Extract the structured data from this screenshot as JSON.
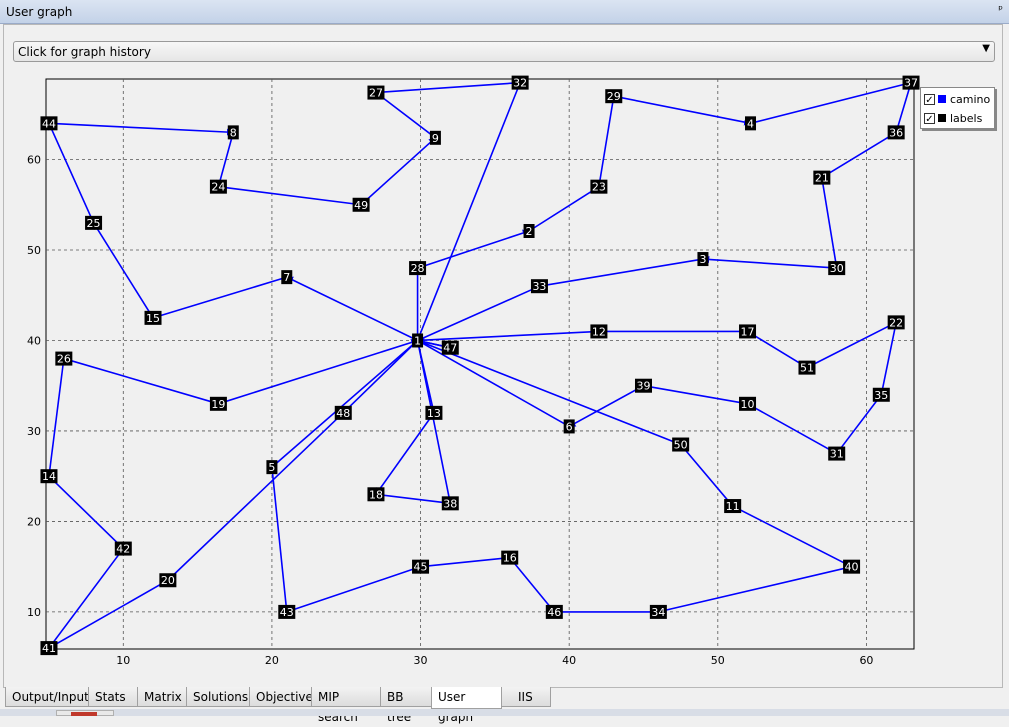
{
  "window": {
    "title": "User graph",
    "pin_glyph": "ᵖ"
  },
  "history": {
    "label": "Click for graph history",
    "dropdown_glyph": "▼"
  },
  "legend": [
    {
      "label": "camino",
      "checked": true,
      "color": "#0000ff"
    },
    {
      "label": "labels",
      "checked": true,
      "color": "#000000"
    }
  ],
  "tabs": [
    "Output/Input",
    "Stats",
    "Matrix",
    "Solutions",
    "Objective",
    "MIP search",
    "BB tree",
    "User graph",
    "IIS"
  ],
  "active_tab": "User graph",
  "chart_data": {
    "type": "scatter",
    "title": "",
    "xlabel": "",
    "ylabel": "",
    "xlim": [
      4.8,
      63.2
    ],
    "ylim": [
      5.9,
      68.9
    ],
    "grid": true,
    "xticks": [
      10,
      20,
      30,
      40,
      50,
      60
    ],
    "yticks": [
      10,
      20,
      30,
      40,
      50,
      60
    ],
    "legend_position": "top-right",
    "edge_color": "#0000ff",
    "nodes": [
      {
        "id": "1",
        "x": 29.8,
        "y": 40
      },
      {
        "id": "2",
        "x": 37.3,
        "y": 52.1
      },
      {
        "id": "3",
        "x": 49.0,
        "y": 49.0
      },
      {
        "id": "4",
        "x": 52.2,
        "y": 64.0
      },
      {
        "id": "5",
        "x": 20.0,
        "y": 26.0
      },
      {
        "id": "6",
        "x": 40.0,
        "y": 30.5
      },
      {
        "id": "7",
        "x": 21.0,
        "y": 47.0
      },
      {
        "id": "8",
        "x": 17.4,
        "y": 63.0
      },
      {
        "id": "9",
        "x": 31.0,
        "y": 62.4
      },
      {
        "id": "10",
        "x": 52.0,
        "y": 33.0
      },
      {
        "id": "11",
        "x": 51.0,
        "y": 21.7
      },
      {
        "id": "12",
        "x": 42.0,
        "y": 41.0
      },
      {
        "id": "13",
        "x": 30.9,
        "y": 32.0
      },
      {
        "id": "14",
        "x": 5.0,
        "y": 25.0
      },
      {
        "id": "15",
        "x": 12.0,
        "y": 42.5
      },
      {
        "id": "16",
        "x": 36.0,
        "y": 16.0
      },
      {
        "id": "17",
        "x": 52.0,
        "y": 41.0
      },
      {
        "id": "18",
        "x": 27.0,
        "y": 23.0
      },
      {
        "id": "19",
        "x": 16.4,
        "y": 33.0
      },
      {
        "id": "20",
        "x": 13.0,
        "y": 13.5
      },
      {
        "id": "21",
        "x": 57.0,
        "y": 58.0
      },
      {
        "id": "22",
        "x": 62.0,
        "y": 42.0
      },
      {
        "id": "23",
        "x": 42.0,
        "y": 57.0
      },
      {
        "id": "24",
        "x": 16.4,
        "y": 57.0
      },
      {
        "id": "25",
        "x": 8.0,
        "y": 53.0
      },
      {
        "id": "26",
        "x": 6.0,
        "y": 38.0
      },
      {
        "id": "27",
        "x": 27.0,
        "y": 67.4
      },
      {
        "id": "28",
        "x": 29.8,
        "y": 48.0
      },
      {
        "id": "29",
        "x": 43.0,
        "y": 67.0
      },
      {
        "id": "30",
        "x": 58.0,
        "y": 48.0
      },
      {
        "id": "31",
        "x": 58.0,
        "y": 27.5
      },
      {
        "id": "32",
        "x": 36.7,
        "y": 68.5
      },
      {
        "id": "33",
        "x": 38.0,
        "y": 46.0
      },
      {
        "id": "34",
        "x": 46.0,
        "y": 10.0
      },
      {
        "id": "35",
        "x": 61.0,
        "y": 34.0
      },
      {
        "id": "36",
        "x": 62.0,
        "y": 63.0
      },
      {
        "id": "37",
        "x": 63.0,
        "y": 68.5
      },
      {
        "id": "38",
        "x": 32.0,
        "y": 22.0
      },
      {
        "id": "39",
        "x": 45.0,
        "y": 35.0
      },
      {
        "id": "40",
        "x": 59.0,
        "y": 15.0
      },
      {
        "id": "41",
        "x": 5.0,
        "y": 6.0
      },
      {
        "id": "42",
        "x": 10.0,
        "y": 17.0
      },
      {
        "id": "43",
        "x": 21.0,
        "y": 10.0
      },
      {
        "id": "44",
        "x": 5.0,
        "y": 64.0
      },
      {
        "id": "45",
        "x": 30.0,
        "y": 15.0
      },
      {
        "id": "46",
        "x": 39.0,
        "y": 10.0
      },
      {
        "id": "47",
        "x": 32.0,
        "y": 39.2
      },
      {
        "id": "48",
        "x": 24.8,
        "y": 32.0
      },
      {
        "id": "49",
        "x": 26.0,
        "y": 55.0
      },
      {
        "id": "50",
        "x": 47.5,
        "y": 28.5
      },
      {
        "id": "51",
        "x": 56.0,
        "y": 37.0
      }
    ],
    "edges": [
      [
        "1",
        "7"
      ],
      [
        "7",
        "15"
      ],
      [
        "15",
        "25"
      ],
      [
        "25",
        "44"
      ],
      [
        "44",
        "8"
      ],
      [
        "8",
        "24"
      ],
      [
        "24",
        "49"
      ],
      [
        "49",
        "9"
      ],
      [
        "9",
        "27"
      ],
      [
        "27",
        "32"
      ],
      [
        "32",
        "1"
      ],
      [
        "1",
        "28"
      ],
      [
        "28",
        "2"
      ],
      [
        "2",
        "23"
      ],
      [
        "23",
        "29"
      ],
      [
        "29",
        "4"
      ],
      [
        "4",
        "37"
      ],
      [
        "37",
        "36"
      ],
      [
        "36",
        "21"
      ],
      [
        "21",
        "30"
      ],
      [
        "30",
        "3"
      ],
      [
        "3",
        "33"
      ],
      [
        "33",
        "1"
      ],
      [
        "1",
        "12"
      ],
      [
        "12",
        "17"
      ],
      [
        "17",
        "51"
      ],
      [
        "51",
        "22"
      ],
      [
        "22",
        "35"
      ],
      [
        "35",
        "31"
      ],
      [
        "31",
        "10"
      ],
      [
        "10",
        "39"
      ],
      [
        "39",
        "6"
      ],
      [
        "6",
        "1"
      ],
      [
        "1",
        "50"
      ],
      [
        "50",
        "11"
      ],
      [
        "11",
        "40"
      ],
      [
        "40",
        "34"
      ],
      [
        "34",
        "46"
      ],
      [
        "46",
        "16"
      ],
      [
        "16",
        "45"
      ],
      [
        "45",
        "43"
      ],
      [
        "43",
        "5"
      ],
      [
        "5",
        "1"
      ],
      [
        "1",
        "13"
      ],
      [
        "13",
        "18"
      ],
      [
        "18",
        "38"
      ],
      [
        "38",
        "1"
      ],
      [
        "1",
        "48"
      ],
      [
        "48",
        "20"
      ],
      [
        "20",
        "41"
      ],
      [
        "41",
        "42"
      ],
      [
        "42",
        "14"
      ],
      [
        "14",
        "26"
      ],
      [
        "26",
        "19"
      ],
      [
        "19",
        "1"
      ],
      [
        "1",
        "47"
      ],
      [
        "47",
        "1"
      ]
    ]
  }
}
